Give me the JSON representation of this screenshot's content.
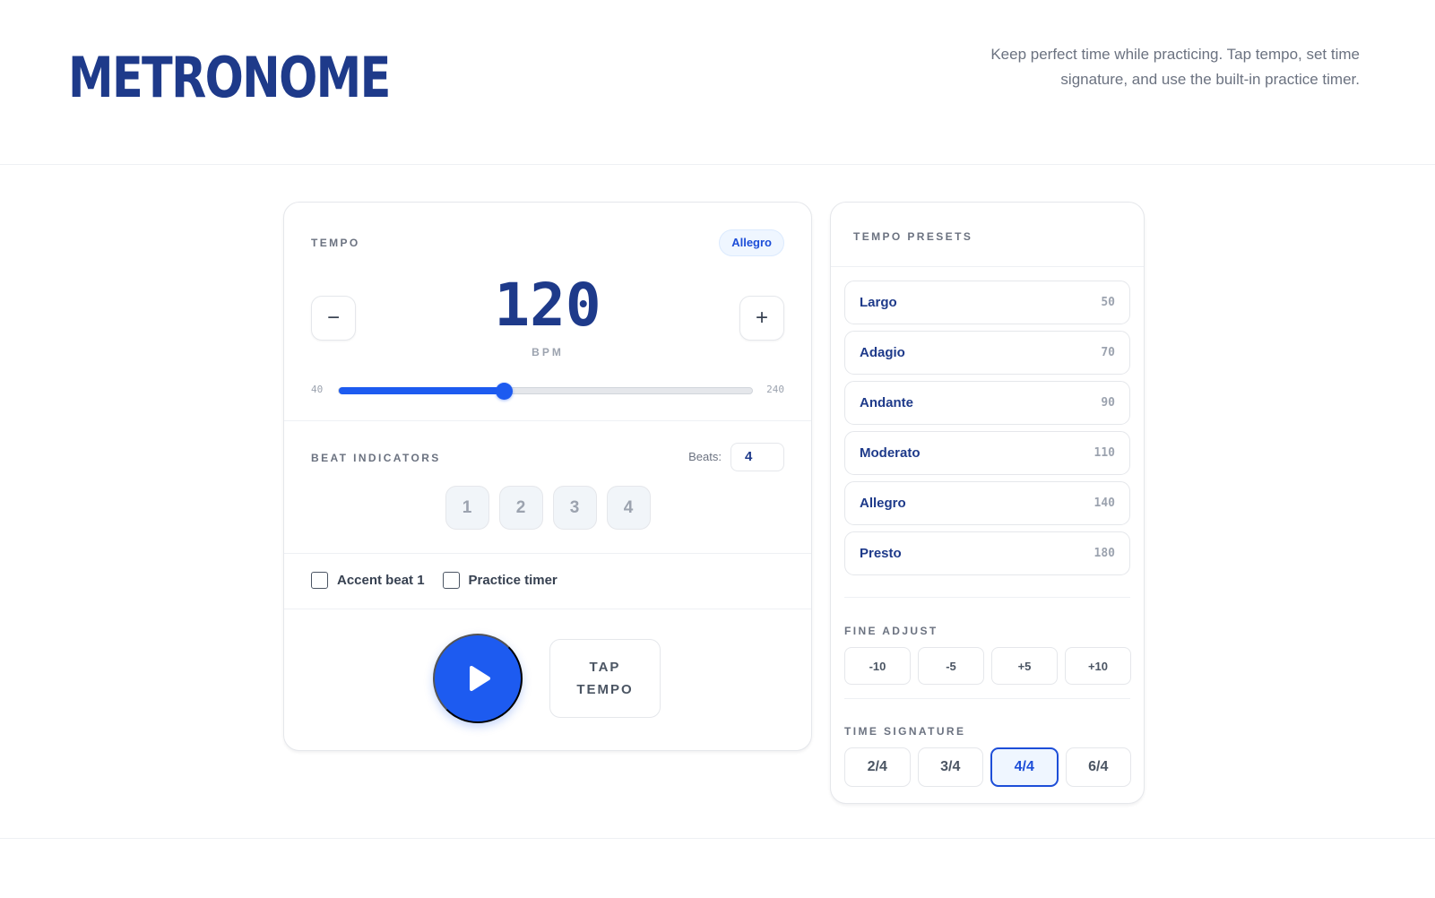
{
  "header": {
    "title": "METRONOME",
    "tagline": "Keep perfect time while practicing. Tap tempo, set time signature, and use the built-in practice timer."
  },
  "tempo": {
    "label": "TEMPO",
    "badge": "Allegro",
    "value": "120",
    "unit": "BPM",
    "decrement": "−",
    "increment": "+",
    "min_label": "40",
    "max_label": "240",
    "min": 40,
    "max": 240,
    "current": 120
  },
  "beats": {
    "label": "BEAT INDICATORS",
    "count_label": "Beats:",
    "count_value": "4",
    "items": [
      "1",
      "2",
      "3",
      "4"
    ]
  },
  "options": {
    "accent_label": "Accent beat 1",
    "timer_label": "Practice timer"
  },
  "transport": {
    "tap_line1": "TAP",
    "tap_line2": "TEMPO"
  },
  "presets": {
    "label": "TEMPO PRESETS",
    "items": [
      {
        "name": "Largo",
        "bpm": "50"
      },
      {
        "name": "Adagio",
        "bpm": "70"
      },
      {
        "name": "Andante",
        "bpm": "90"
      },
      {
        "name": "Moderato",
        "bpm": "110"
      },
      {
        "name": "Allegro",
        "bpm": "140"
      },
      {
        "name": "Presto",
        "bpm": "180"
      }
    ]
  },
  "fine_adjust": {
    "label": "FINE ADJUST",
    "items": [
      "-10",
      "-5",
      "+5",
      "+10"
    ]
  },
  "time_signature": {
    "label": "TIME SIGNATURE",
    "items": [
      "2/4",
      "3/4",
      "4/4",
      "6/4"
    ],
    "selected": "4/4"
  },
  "colors": {
    "accent": "#1d5bf0",
    "title": "#1e3a8a"
  }
}
